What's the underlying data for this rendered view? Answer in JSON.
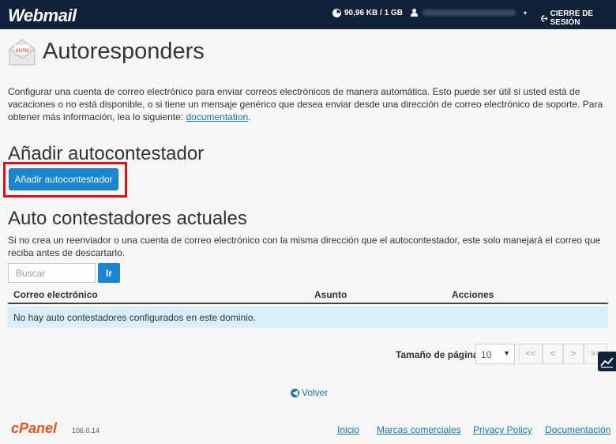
{
  "header": {
    "logo": "Webmail",
    "disk_usage": "90,96 KB / 1 GB",
    "user_menu_caret": "▾",
    "logout_label": "CIERRE DE SESIÓN"
  },
  "page": {
    "title": "Autoresponders",
    "icon_label": "AUTO",
    "intro_text": "Configurar una cuenta de correo electrónico para enviar correos electrónicos de manera automática. Esto puede ser útil si usted está de vacaciones o no está disponible, o si tiene un mensaje genérico que desea enviar desde una dirección de correo electrónico de soporte. Para obtener más información, lea lo siguiente: ",
    "intro_link": "documentation",
    "intro_end": "."
  },
  "add_section": {
    "heading": "Añadir autocontestador",
    "button_label": "Añadir autocontestador"
  },
  "current_section": {
    "heading": "Auto contestadores actuales",
    "note": "Si no crea un reenviador o una cuenta de correo electrónico con la misma dirección que el autocontestador, este solo manejará el correo que reciba antes de descartarlo.",
    "search_placeholder": "Buscar",
    "search_button": "Ir",
    "columns": [
      "Correo electrónico",
      "Asunto",
      "Acciones"
    ],
    "empty_message": "No hay auto contestadores configurados en este dominio."
  },
  "pagination": {
    "page_size_label": "Tamaño de página",
    "page_size_value": "10",
    "first": "<<",
    "prev": "<",
    "next": ">",
    "last": ">>"
  },
  "back_link": "Volver",
  "footer": {
    "logo": "cPanel",
    "version": "106.0.14",
    "links": [
      "Inicio",
      "Marcas comerciales",
      "Privacy Policy",
      "Documentación"
    ]
  },
  "colors": {
    "topbar": "#0f2239",
    "primary_button": "#1a85d0",
    "highlight_border": "#d7141a",
    "empty_row_bg": "#d8eef8",
    "link": "#1a74b8",
    "cpanel_orange": "#e8541e"
  }
}
